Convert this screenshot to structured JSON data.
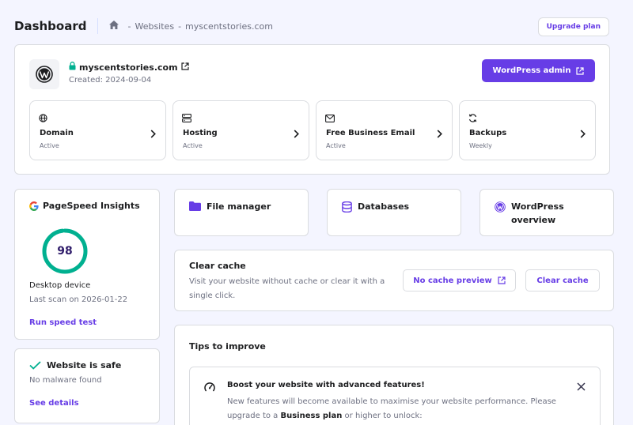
{
  "header": {
    "title": "Dashboard",
    "breadcrumb": [
      "Websites",
      "myscentstories.com"
    ],
    "upgrade_label": "Upgrade plan"
  },
  "site": {
    "domain": "myscentstories.com",
    "created": "Created: 2024-09-04",
    "wp_admin_label": "WordPress admin",
    "services": [
      {
        "title": "Domain",
        "status": "Active",
        "icon": "globe-icon"
      },
      {
        "title": "Hosting",
        "status": "Active",
        "icon": "server-icon"
      },
      {
        "title": "Free Business Email",
        "status": "Active",
        "icon": "mail-icon"
      },
      {
        "title": "Backups",
        "status": "Weekly",
        "icon": "sync-icon"
      }
    ]
  },
  "pagespeed": {
    "title": "PageSpeed Insights",
    "score": "98",
    "score_fraction": 0.98,
    "device": "Desktop device",
    "last_scan": "Last scan on 2026-01-22",
    "link": "Run speed test"
  },
  "security": {
    "title": "Website is safe",
    "subtitle": "No malware found",
    "link": "See details"
  },
  "tools": [
    {
      "label": "File manager",
      "icon": "folder-icon"
    },
    {
      "label": "Databases",
      "icon": "database-icon"
    },
    {
      "label": "WordPress overview",
      "icon": "wordpress-icon"
    }
  ],
  "cache": {
    "title": "Clear cache",
    "description": "Visit your website without cache or clear it with a single click.",
    "preview_label": "No cache preview",
    "clear_label": "Clear cache"
  },
  "tips": {
    "title": "Tips to improve",
    "item_title": "Boost your website with advanced features!",
    "item_body_before": "New features will become available to maximise your website performance. Please upgrade to a ",
    "item_body_bold": "Business plan",
    "item_body_after": " or higher to unlock:"
  },
  "colors": {
    "accent": "#673de6",
    "success": "#00b090",
    "background": "#f4f5ff"
  }
}
